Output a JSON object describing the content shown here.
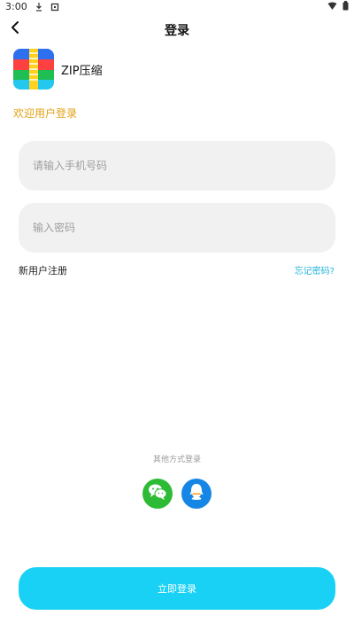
{
  "status_bar": {
    "time": "3:00",
    "left_icons": [
      "download-icon",
      "app-notification-icon"
    ],
    "right_icons": [
      "wifi-icon",
      "battery-icon"
    ]
  },
  "header": {
    "title": "登录",
    "back_icon": "chevron-left-icon"
  },
  "brand": {
    "name": "ZIP压缩",
    "logo_icon": "zip-archive-icon"
  },
  "welcome_text": "欢迎用户登录",
  "login_form": {
    "phone_placeholder": "请输入手机号码",
    "phone_value": "",
    "password_placeholder": "输入密码",
    "password_value": "",
    "register_link": "新用户注册",
    "forgot_password_link": "忘记密码?"
  },
  "other_login": {
    "label": "其他方式登录",
    "providers": [
      {
        "name": "wechat",
        "icon": "wechat-icon",
        "color": "#2dbb35"
      },
      {
        "name": "qq",
        "icon": "qq-icon",
        "color": "#1586e5"
      }
    ]
  },
  "primary_action": {
    "label": "立即登录",
    "color": "#19d1f4"
  },
  "colors": {
    "accent": "#19d1f4",
    "welcome": "#e1a115",
    "link": "#24b4d8",
    "input_background": "#f1f1f1"
  }
}
